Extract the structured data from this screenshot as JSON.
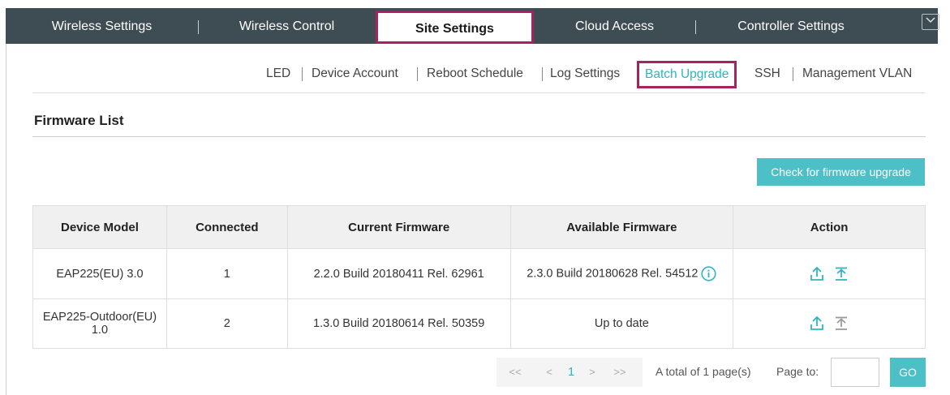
{
  "topnav": {
    "tabs": [
      {
        "label": "Wireless Settings"
      },
      {
        "label": "Wireless Control"
      },
      {
        "label": "Site Settings"
      },
      {
        "label": "Cloud Access"
      },
      {
        "label": "Controller Settings"
      }
    ],
    "active_tab": "Site Settings",
    "collapse_icon": "chevron-down-icon"
  },
  "subnav": {
    "items": [
      {
        "label": "LED"
      },
      {
        "label": "Device Account"
      },
      {
        "label": "Reboot Schedule"
      },
      {
        "label": "Log Settings"
      },
      {
        "label": "Batch Upgrade"
      },
      {
        "label": "SSH"
      },
      {
        "label": "Management VLAN"
      }
    ],
    "active_item": "Batch Upgrade"
  },
  "section": {
    "title": "Firmware List",
    "check_button": "Check for firmware upgrade"
  },
  "table": {
    "headers": [
      "Device Model",
      "Connected",
      "Current Firmware",
      "Available Firmware",
      "Action"
    ],
    "rows": [
      {
        "model": "EAP225(EU) 3.0",
        "connected": "1",
        "current": "2.2.0 Build 20180411 Rel. 62961",
        "available": "2.3.0 Build 20180628 Rel. 54512",
        "has_info_icon": true,
        "actions": [
          "upgrade-icon",
          "upload-firmware-icon"
        ]
      },
      {
        "model": "EAP225-Outdoor(EU) 1.0",
        "connected": "2",
        "current": "1.3.0 Build 20180614 Rel. 50359",
        "available": "Up to date",
        "has_info_icon": false,
        "actions": [
          "upgrade-icon",
          "upload-firmware-icon"
        ]
      }
    ]
  },
  "pagination": {
    "first": "<<",
    "prev": "<",
    "current_page": "1",
    "next": ">",
    "last": ">>",
    "total_text": "A total of 1 page(s)",
    "page_to_label": "Page to:",
    "page_input_value": "",
    "go_label": "GO"
  },
  "colors": {
    "nav_bg": "#3e4c54",
    "accent": "#4dbfc6",
    "highlight_border": "#a8225f",
    "active_link": "#31b4bd"
  }
}
